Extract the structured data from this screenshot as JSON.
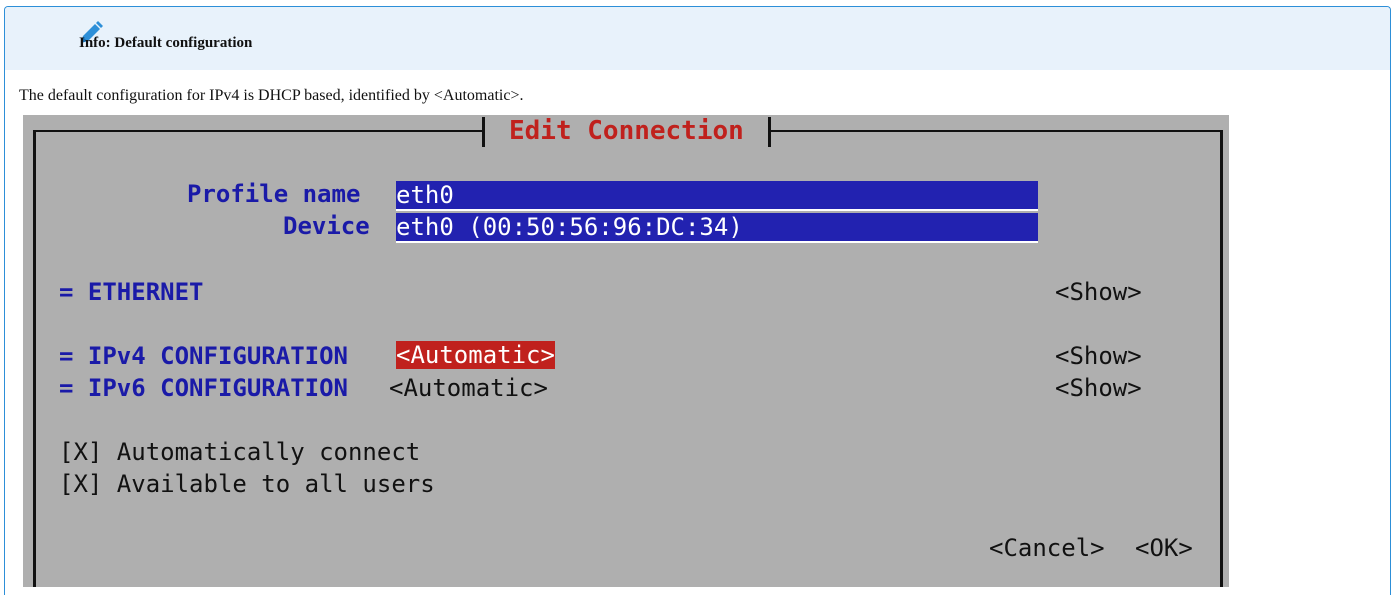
{
  "callout": {
    "icon": "pencil-icon",
    "title": "Info: Default configuration",
    "text": "The default configuration for IPv4 is DHCP based, identified by <Automatic>."
  },
  "terminal": {
    "title": "Edit Connection",
    "profile_name_label": "Profile name",
    "profile_name_value": "eth0",
    "device_label": "Device",
    "device_value": "eth0 (00:50:56:96:DC:34)",
    "ethernet_label": "= ETHERNET",
    "ethernet_show": "<Show>",
    "ipv4_label": "= IPv4 CONFIGURATION",
    "ipv4_value": "<Automatic>",
    "ipv4_show": "<Show>",
    "ipv6_label": "= IPv6 CONFIGURATION",
    "ipv6_value": "<Automatic>",
    "ipv6_show": "<Show>",
    "auto_connect": "[X] Automatically connect",
    "all_users": "[X] Available to all users",
    "cancel": "<Cancel>",
    "ok": "<OK>"
  },
  "colors": {
    "accent": "#2d8fd8",
    "terminal_bg": "#afafaf",
    "field_bg": "#2222b0",
    "highlight": "#c0211d"
  }
}
